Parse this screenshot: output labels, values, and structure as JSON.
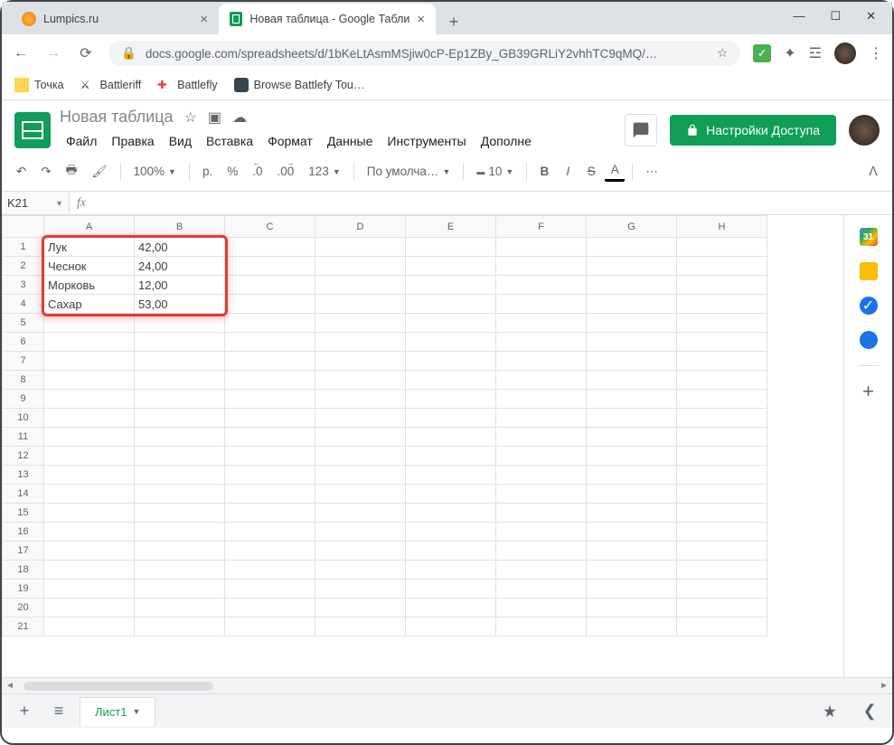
{
  "window": {
    "controls": [
      "minimize",
      "maximize",
      "close"
    ]
  },
  "browser": {
    "tabs": [
      {
        "title": "Lumpics.ru",
        "active": false,
        "favicon": "orange"
      },
      {
        "title": "Новая таблица - Google Таблиц…",
        "active": true,
        "favicon": "sheets"
      }
    ],
    "nav": {
      "back": "←",
      "forward": "→",
      "reload": "⟳"
    },
    "url_host": "docs.google.com",
    "url_path": "/spreadsheets/d/1bKeLtAsmMSjiw0cP-Ep1ZBy_GB39GRLiY2vhhTC9qMQ/…",
    "star": "☆",
    "extensions": [
      "check",
      "puzzle",
      "list",
      "avatar",
      "menu"
    ]
  },
  "bookmarks": [
    {
      "label": "Точка"
    },
    {
      "label": "Battleriff"
    },
    {
      "label": "Battlefly"
    },
    {
      "label": "Browse Battlefy Tou…"
    }
  ],
  "sheets": {
    "doc_title": "Новая таблица",
    "title_icons": [
      "star",
      "folder",
      "cloud"
    ],
    "menu": [
      "Файл",
      "Правка",
      "Вид",
      "Вставка",
      "Формат",
      "Данные",
      "Инструменты",
      "Дополне"
    ],
    "share_label": "Настройки Доступа",
    "toolbar": {
      "zoom": "100%",
      "currency": "р.",
      "percent": "%",
      "dec_dec": ".0",
      "dec_inc": ".00",
      "format": "123",
      "font": "По умолча…",
      "size": "10",
      "bold": "B",
      "italic": "I",
      "strike": "S",
      "textcolor": "A",
      "more": "⋯"
    },
    "name_box": "K21",
    "fx_label": "fx",
    "columns": [
      "A",
      "B",
      "C",
      "D",
      "E",
      "F",
      "G",
      "H"
    ],
    "row_count": 21,
    "data": [
      {
        "a": "Лук",
        "b": "42,00"
      },
      {
        "a": "Чеснок",
        "b": "24,00"
      },
      {
        "a": "Морковь",
        "b": "12,00"
      },
      {
        "a": "Сахар",
        "b": "53,00"
      }
    ],
    "sheet_tab": "Лист1"
  },
  "side_icons": [
    "calendar",
    "keep",
    "tasks",
    "contacts",
    "plus"
  ]
}
